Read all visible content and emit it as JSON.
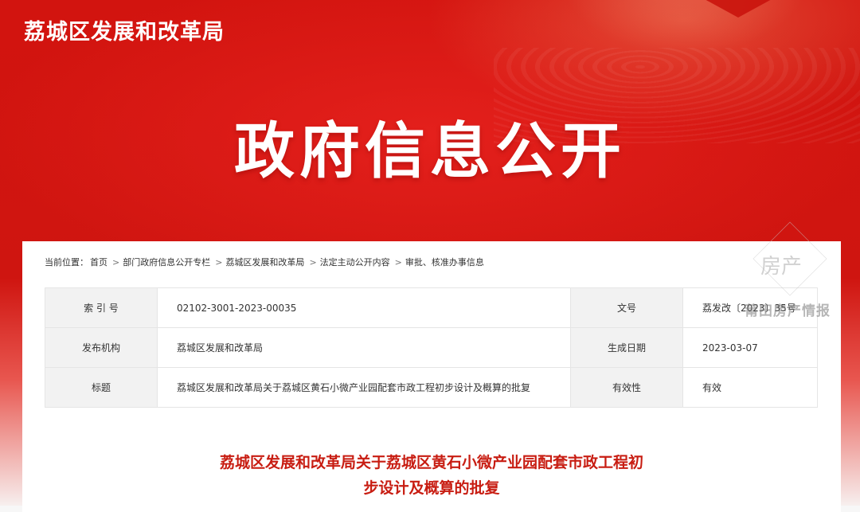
{
  "header": {
    "site_title": "荔城区发展和改革局",
    "hero_title": "政府信息公开"
  },
  "breadcrumb": {
    "label": "当前位置：",
    "items": [
      "首页",
      "部门政府信息公开专栏",
      "荔城区发展和改革局",
      "法定主动公开内容",
      "审批、核准办事信息"
    ],
    "separator": ">"
  },
  "meta_table": {
    "rows": [
      {
        "k1": "索 引 号",
        "v1": "02102-3001-2023-00035",
        "k2": "文号",
        "v2": "荔发改〔2023〕35号"
      },
      {
        "k1": "发布机构",
        "v1": "荔城区发展和改革局",
        "k2": "生成日期",
        "v2": "2023-03-07"
      },
      {
        "k1": "标题",
        "v1": "荔城区发展和改革局关于荔城区黄石小微产业园配套市政工程初步设计及概算的批复",
        "k2": "有效性",
        "v2": "有效"
      }
    ]
  },
  "document": {
    "title_line1": "荔城区发展和改革局关于荔城区黄石小微产业园配套市政工程初",
    "title_line2": "步设计及概算的批复"
  },
  "watermark": {
    "line1": "房产",
    "line2": "莆田房产情报"
  },
  "colors": {
    "banner_red": "#d2140f",
    "title_red": "#c81d12"
  }
}
